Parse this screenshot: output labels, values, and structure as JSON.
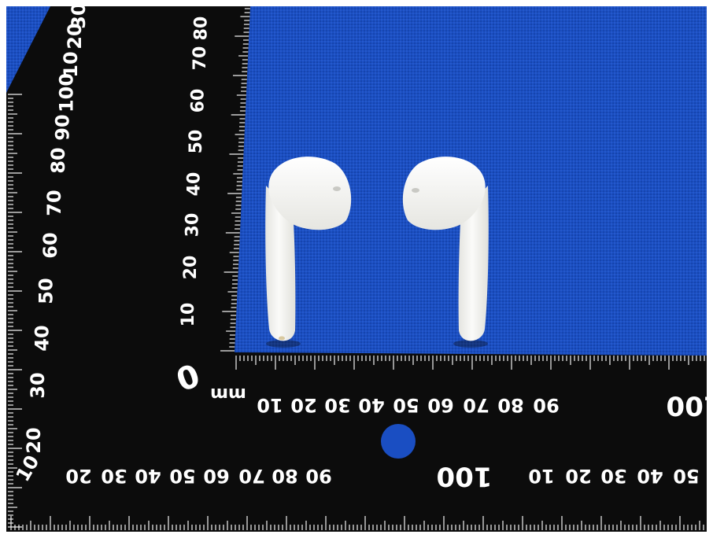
{
  "scene": {
    "subject": "pair of white wireless earbuds on blue cloth next to an L-shaped black ruler",
    "colors": {
      "cloth": "#1a4ec2",
      "cloth_dark": "#123c9a",
      "ruler": "#0c0c0c",
      "ruler_marks": "#f2f2f2",
      "earbud": "#f4f4f1",
      "earbud_shadow": "#d7d7d2",
      "border": "#ffffff"
    }
  },
  "ruler": {
    "vertical_labels": [
      "10",
      "20",
      "30",
      "40",
      "50",
      "60",
      "70",
      "80",
      "90",
      "100",
      "10",
      "20"
    ],
    "vertical_left_labels": [
      "20",
      "30",
      "40",
      "50",
      "60",
      "70",
      "80",
      "90",
      "100",
      "10",
      "20",
      "30",
      "40"
    ],
    "zero_label": "0",
    "unit_label": "mm",
    "horizontal_top_labels": [
      "10",
      "20",
      "30",
      "40",
      "50",
      "60",
      "70",
      "80",
      "90",
      "100"
    ],
    "horizontal_bottom_labels": [
      "20",
      "30",
      "40",
      "50",
      "60",
      "70",
      "80",
      "90",
      "100",
      "10",
      "20",
      "30",
      "40",
      "50"
    ],
    "corner_label": "10"
  }
}
